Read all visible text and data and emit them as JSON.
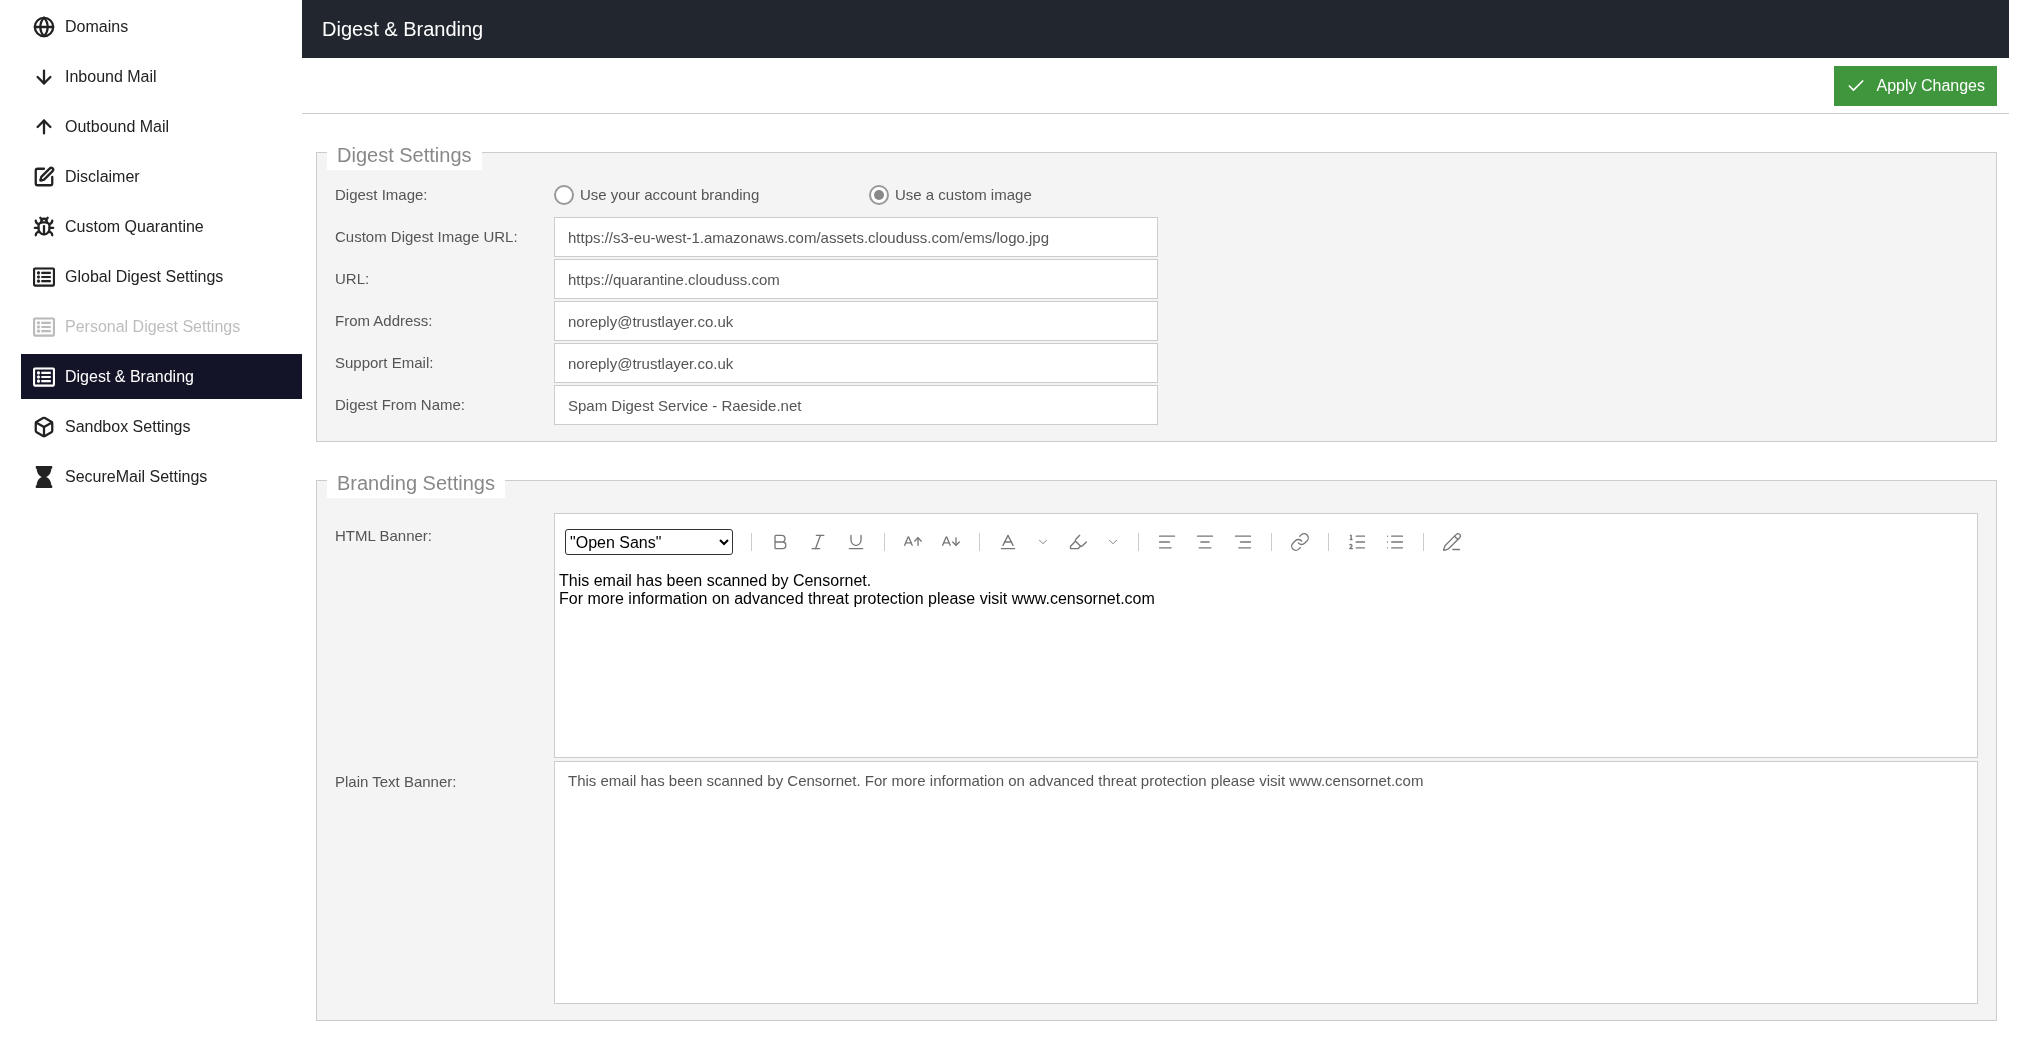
{
  "sidebar": {
    "items": [
      {
        "label": "Domains",
        "selected": false,
        "disabled": false
      },
      {
        "label": "Inbound Mail",
        "selected": false,
        "disabled": false
      },
      {
        "label": "Outbound Mail",
        "selected": false,
        "disabled": false
      },
      {
        "label": "Disclaimer",
        "selected": false,
        "disabled": false
      },
      {
        "label": "Custom Quarantine",
        "selected": false,
        "disabled": false
      },
      {
        "label": "Global Digest Settings",
        "selected": false,
        "disabled": false
      },
      {
        "label": "Personal Digest Settings",
        "selected": false,
        "disabled": true
      },
      {
        "label": "Digest & Branding",
        "selected": true,
        "disabled": false
      },
      {
        "label": "Sandbox Settings",
        "selected": false,
        "disabled": false
      },
      {
        "label": "SecureMail Settings",
        "selected": false,
        "disabled": false
      }
    ]
  },
  "header": {
    "title": "Digest & Branding"
  },
  "apply_button": "Apply Changes",
  "digest_settings": {
    "legend": "Digest Settings",
    "image_label": "Digest Image:",
    "image_options": [
      {
        "label": "Use your account branding",
        "selected": false
      },
      {
        "label": "Use a custom image",
        "selected": true
      }
    ],
    "fields": [
      {
        "label": "Custom Digest Image URL:",
        "value": "https://s3-eu-west-1.amazonaws.com/assets.clouduss.com/ems/logo.jpg"
      },
      {
        "label": "URL:",
        "value": "https://quarantine.clouduss.com"
      },
      {
        "label": "From Address:",
        "value": "noreply@trustlayer.co.uk"
      },
      {
        "label": "Support Email:",
        "value": "noreply@trustlayer.co.uk"
      },
      {
        "label": "Digest From Name:",
        "value": "Spam Digest Service - Raeside.net"
      }
    ]
  },
  "branding_settings": {
    "legend": "Branding Settings",
    "html_label": "HTML Banner:",
    "font": "\"Open Sans\"",
    "html_lines": [
      "This email has been scanned by Censornet.",
      "For more information on advanced threat protection please visit www.censornet.com"
    ],
    "plain_label": "Plain Text Banner:",
    "plain_value": "This email has been scanned by Censornet. For more information on advanced threat protection please visit www.censornet.com"
  }
}
